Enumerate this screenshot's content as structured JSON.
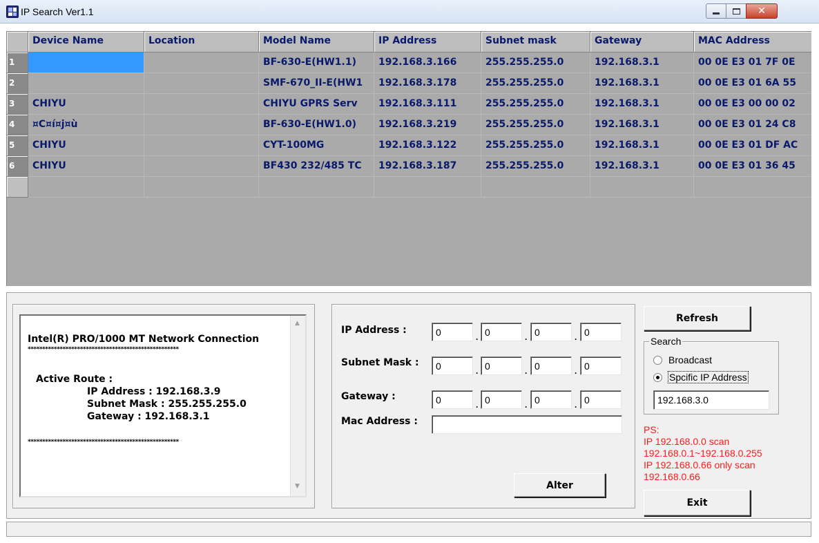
{
  "window": {
    "title": "IP Search Ver1.1",
    "close_glyph": "✕"
  },
  "grid": {
    "columns": [
      "Device Name",
      "Location",
      "Model Name",
      "IP Address",
      "Subnet mask",
      "Gateway",
      "MAC Address"
    ],
    "rows": [
      {
        "num": "1",
        "cells": [
          "",
          "",
          "BF-630-E(HW1.1)",
          "192.168.3.166",
          "255.255.255.0",
          "192.168.3.1",
          "00 0E E3 01 7F 0E"
        ]
      },
      {
        "num": "2",
        "cells": [
          "",
          "",
          "SMF-670_II-E(HW1",
          "192.168.3.178",
          "255.255.255.0",
          "192.168.3.1",
          "00 0E E3 01 6A 55"
        ]
      },
      {
        "num": "3",
        "cells": [
          "CHIYU",
          "",
          "CHIYU GPRS Serv",
          "192.168.3.111",
          "255.255.255.0",
          "192.168.3.1",
          "00 0E E3 00 00 02"
        ]
      },
      {
        "num": "4",
        "cells": [
          "¤C¤í¤j¤ù",
          "",
          "BF-630-E(HW1.0)",
          "192.168.3.219",
          "255.255.255.0",
          "192.168.3.1",
          "00 0E E3 01 24 C8"
        ]
      },
      {
        "num": "5",
        "cells": [
          "CHIYU",
          "",
          "CYT-100MG",
          "192.168.3.122",
          "255.255.255.0",
          "192.168.3.1",
          "00 0E E3 01 DF AC"
        ]
      },
      {
        "num": "6",
        "cells": [
          "CHIYU",
          "",
          "BF430 232/485 TC",
          "192.168.3.187",
          "255.255.255.0",
          "192.168.3.1",
          "00 0E E3 01 36 45"
        ]
      },
      {
        "num": "",
        "cells": [
          "",
          "",
          "",
          "",
          "",
          "",
          ""
        ]
      }
    ]
  },
  "info": {
    "adapter": "Intel(R) PRO/1000 MT Network Connection",
    "separator": "****************************************************",
    "active_route": "Active Route :",
    "ip": "IP Address : 192.168.3.9",
    "mask": "Subnet Mask : 255.255.255.0",
    "gateway": "Gateway : 192.168.3.1",
    "separator2": "****************************************************"
  },
  "config": {
    "ip_label": "IP Address :",
    "mask_label": "Subnet Mask :",
    "gateway_label": "Gateway :",
    "mac_label": "Mac Address :",
    "ip": [
      "0",
      "0",
      "0",
      "0"
    ],
    "mask": [
      "0",
      "0",
      "0",
      "0"
    ],
    "gateway": [
      "0",
      "0",
      "0",
      "0"
    ],
    "mac": "",
    "dot": ".",
    "alter_label": "Alter"
  },
  "search": {
    "refresh_label": "Refresh",
    "group_label": "Search",
    "broadcast_label": "Broadcast",
    "specific_label": "Spcific IP Address",
    "selected": "specific",
    "specific_ip": "192.168.3.0",
    "ps_lines": [
      "PS:",
      "IP 192.168.0.0 scan",
      "192.168.0.1~192.168.0.255",
      "IP 192.168.0.66 only scan",
      "192.168.0.66"
    ],
    "exit_label": "Exit"
  },
  "colors": {
    "grid_text": "#0a1a6b",
    "selection": "#3399ff",
    "hint_text": "#ff1a1a"
  }
}
